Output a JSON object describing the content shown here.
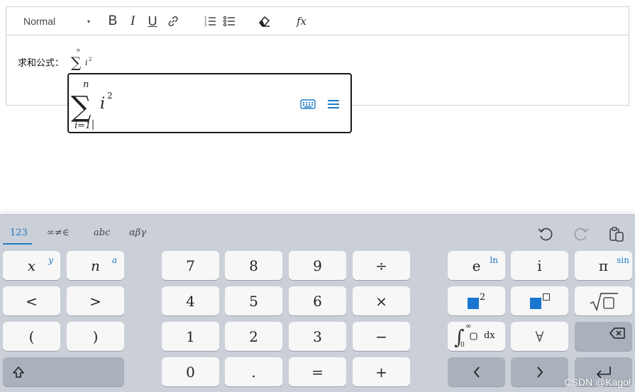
{
  "toolbar": {
    "format_select": "Normal",
    "bold": "B",
    "italic": "I",
    "underline": "U",
    "formula": "fx"
  },
  "content": {
    "label": "求和公式：",
    "inline_sum_upper": "n",
    "inline_sum_term": "i",
    "inline_sum_exp": "2"
  },
  "mathfield": {
    "upper": "n",
    "lower": "i=1",
    "term": "i",
    "exp": "2"
  },
  "keyboard": {
    "tabs": [
      "123",
      "∞≠∈",
      "abc",
      "αβγ"
    ],
    "active_tab": "123",
    "keys": {
      "x": "x",
      "x_shift": "y",
      "n": "n",
      "n_shift": "a",
      "lt": "<",
      "gt": ">",
      "lparen": "(",
      "rparen": ")",
      "d7": "7",
      "d8": "8",
      "d9": "9",
      "div": "÷",
      "d4": "4",
      "d5": "5",
      "d6": "6",
      "mul": "×",
      "d1": "1",
      "d2": "2",
      "d3": "3",
      "minus": "−",
      "d0": "0",
      "dot": ".",
      "eq": "=",
      "plus": "+",
      "e": "e",
      "e_shift": "ln",
      "i": "i",
      "pi": "π",
      "pi_shift": "sin",
      "sq_exp": "2",
      "integral_dx": "dx",
      "integral_upper": "∞",
      "integral_lower": "0",
      "forall": "∀"
    }
  },
  "watermark": "CSDN @Kagol",
  "colors": {
    "accent": "#1f7ac4",
    "keyboard_bg": "#cbd0d8",
    "key_bg": "#f7f7f8",
    "dark_key_bg": "#a9b1bc",
    "placeholder_blue": "#1876d1"
  }
}
